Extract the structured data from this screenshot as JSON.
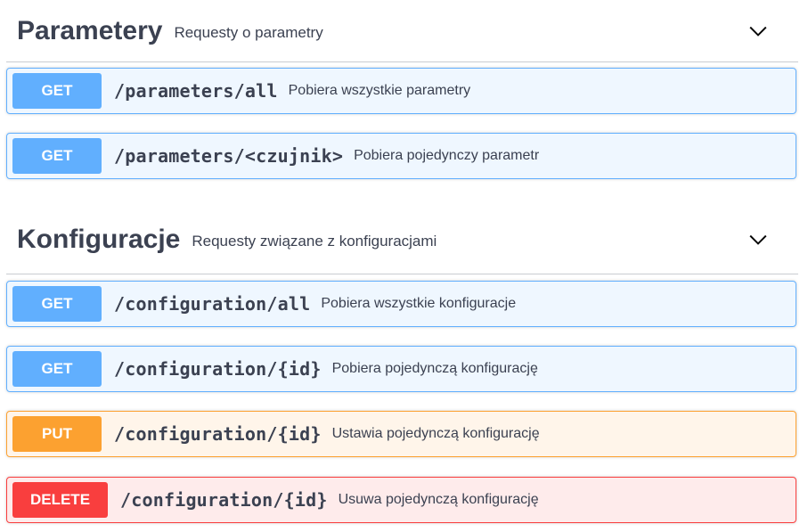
{
  "sections": [
    {
      "title": "Parametery",
      "description": "Requesty o parametry",
      "toggle_icon": "chevron-down-icon",
      "operations": [
        {
          "method": "GET",
          "path": "/parameters/all",
          "summary": "Pobiera wszystkie parametry"
        },
        {
          "method": "GET",
          "path": "/parameters/<czujnik>",
          "summary": "Pobiera pojedynczy parametr"
        }
      ]
    },
    {
      "title": "Konfiguracje",
      "description": "Requesty związane z konfiguracjami",
      "toggle_icon": "chevron-down-icon",
      "operations": [
        {
          "method": "GET",
          "path": "/configuration/all",
          "summary": "Pobiera wszystkie konfiguracje"
        },
        {
          "method": "GET",
          "path": "/configuration/{id}",
          "summary": "Pobiera pojedynczą konfigurację"
        },
        {
          "method": "PUT",
          "path": "/configuration/{id}",
          "summary": "Ustawia pojedynczą konfigurację"
        },
        {
          "method": "DELETE",
          "path": "/configuration/{id}",
          "summary": "Usuwa pojedynczą konfigurację"
        }
      ]
    }
  ],
  "colors": {
    "get": "#61affe",
    "put": "#fca130",
    "delete": "#f93e3e",
    "text": "#3b4151"
  }
}
